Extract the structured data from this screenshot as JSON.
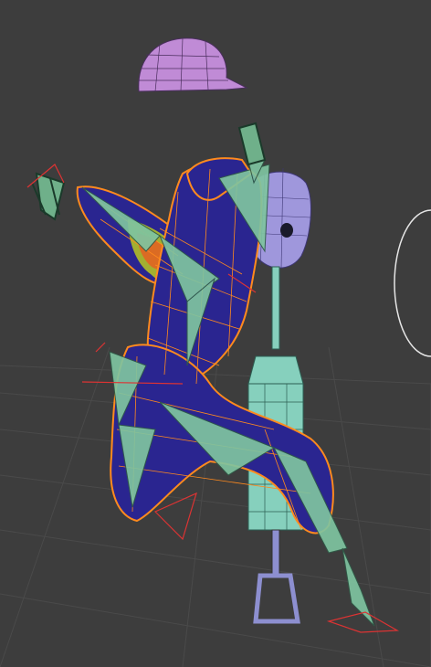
{
  "viewport": {
    "background": "#3d3d3d",
    "grid_color": "#4a4a4a",
    "wire_color": "#ff8a1e",
    "mesh_fill": "#2a2590",
    "bone_color": "#7fc4a0",
    "head_color": "#9f97dc",
    "cap_color": "#c08bd6",
    "pedestal_color": "#86d0bd"
  },
  "scene": {
    "objects": [
      {
        "name": "cap",
        "icon": "cap-mesh"
      },
      {
        "name": "head",
        "icon": "head-mesh"
      },
      {
        "name": "character-body",
        "icon": "armature-mesh"
      },
      {
        "name": "syringe-stand",
        "icon": "stand-mesh"
      }
    ]
  }
}
